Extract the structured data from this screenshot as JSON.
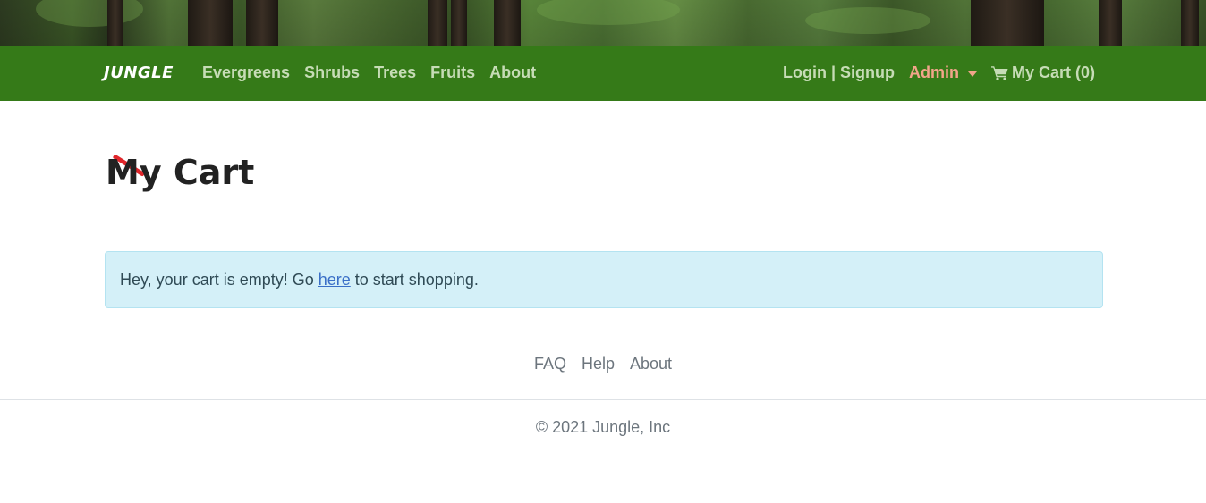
{
  "navbar": {
    "brand": "JUNGLE",
    "links": [
      "Evergreens",
      "Shrubs",
      "Trees",
      "Fruits",
      "About"
    ],
    "auth_label": "Login | Signup",
    "admin_label": "Admin",
    "cart_label": "My Cart (0)",
    "background_color": "#357a18",
    "link_color": "#c6dcb6",
    "admin_color": "#f2a58a"
  },
  "main": {
    "title": "My Cart",
    "alert": {
      "text_before": "Hey, your cart is empty! Go ",
      "link_label": "here",
      "text_after": " to start shopping."
    }
  },
  "footer": {
    "links": [
      "FAQ",
      "Help",
      "About"
    ],
    "copyright": "© 2021 Jungle, Inc"
  },
  "icons": {
    "cart": "shopping-cart-icon",
    "dropdown": "caret-down-icon",
    "title_accent": "title-accent-mark"
  }
}
